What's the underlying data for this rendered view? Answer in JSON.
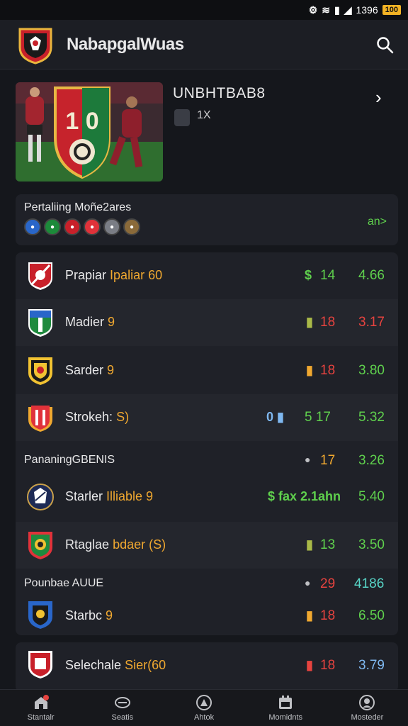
{
  "status": {
    "time": "1396",
    "battery": "100"
  },
  "appbar": {
    "title": "NabapgalWuas"
  },
  "hero": {
    "title": "UNBHTBAB8",
    "count": "1X",
    "score_text": "1 0"
  },
  "filter": {
    "title": "Pertaliing Moñe2ares",
    "more": "an>"
  },
  "rows": [
    {
      "name": "Prapiar",
      "highlight": "Ipaliar 60",
      "mark": "$",
      "mark_color": "#5fd04d",
      "num": "14",
      "num_color": "#5fd04d",
      "odds": "4.66",
      "odds_color": "#5fd04d"
    },
    {
      "name": "Madier",
      "highlight": "9",
      "mark": "▮",
      "mark_color": "#a9b948",
      "num": "18",
      "num_color": "#e6433f",
      "odds": "3.17",
      "odds_color": "#e6433f"
    },
    {
      "name": "Sarder",
      "highlight": "9",
      "mark": "▮",
      "mark_color": "#f0a830",
      "num": "18",
      "num_color": "#e6433f",
      "odds": "3.80",
      "odds_color": "#5fd04d"
    },
    {
      "name": "Strokeh:",
      "highlight": "S)",
      "mark": "0 ▮",
      "mark_color": "#7fb8f0",
      "num": "5 17",
      "num_color": "#5fd04d",
      "odds": "5.32",
      "odds_color": "#5fd04d"
    },
    {
      "name": "Starler",
      "highlight": "Illiable 9",
      "mark": "$ fax 2.1ahn",
      "mark_color": "#5fd04d",
      "num": "",
      "num_color": "#5fd04d",
      "odds": "5.40",
      "odds_color": "#5fd04d"
    },
    {
      "name": "Rtaglae",
      "highlight": "bdaer (S)",
      "mark": "▮",
      "mark_color": "#a9b948",
      "num": "13",
      "num_color": "#5fd04d",
      "odds": "3.50",
      "odds_color": "#5fd04d"
    },
    {
      "name": "Starbc",
      "highlight": "9",
      "mark": "▮",
      "mark_color": "#f0a830",
      "num": "18",
      "num_color": "#e6433f",
      "odds": "6.50",
      "odds_color": "#5fd04d"
    }
  ],
  "sections": [
    {
      "title": "PananingGBENIS",
      "mark": "●",
      "num": "17",
      "num_color": "#f0a830",
      "odds": "3.26",
      "odds_color": "#5fd04d"
    },
    {
      "title": "Pounbae AUUE",
      "mark": "●",
      "num": "29",
      "num_color": "#e6433f",
      "odds": "4186",
      "odds_color": "#57d4c6"
    }
  ],
  "card2": {
    "name": "Selechale",
    "highlight": "Sier(60",
    "mark": "▮",
    "mark_color": "#e6433f",
    "num": "18",
    "num_color": "#e6433f",
    "odds": "3.79",
    "odds_color": "#7fb8f0"
  },
  "tabs": [
    {
      "label": "Stantalr",
      "icon": "home-icon"
    },
    {
      "label": "Seatis",
      "icon": "football-icon"
    },
    {
      "label": "Ahtok",
      "icon": "target-icon"
    },
    {
      "label": "Momidnts",
      "icon": "calendar-icon"
    },
    {
      "label": "Mosteder",
      "icon": "profile-icon"
    }
  ]
}
